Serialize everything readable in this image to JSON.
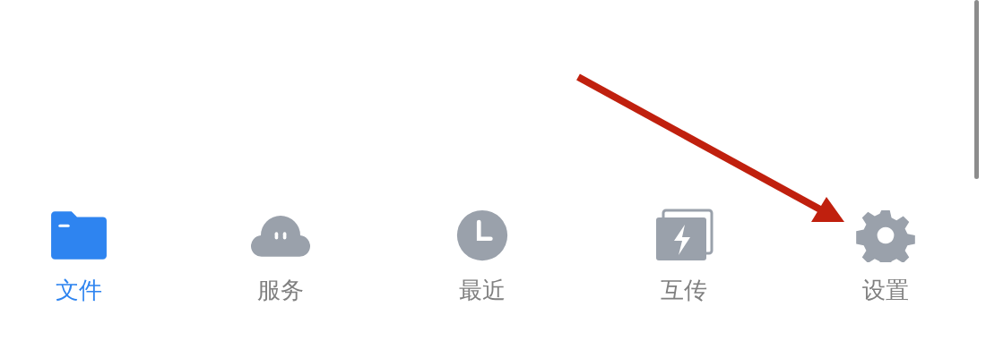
{
  "tab_bar": {
    "tabs": [
      {
        "label": "文件",
        "kind": "folder",
        "selected": true
      },
      {
        "label": "服务",
        "kind": "cloud",
        "selected": false
      },
      {
        "label": "最近",
        "kind": "clock",
        "selected": false
      },
      {
        "label": "互传",
        "kind": "transfer",
        "selected": false
      },
      {
        "label": "设置",
        "kind": "gear",
        "selected": false
      }
    ]
  }
}
